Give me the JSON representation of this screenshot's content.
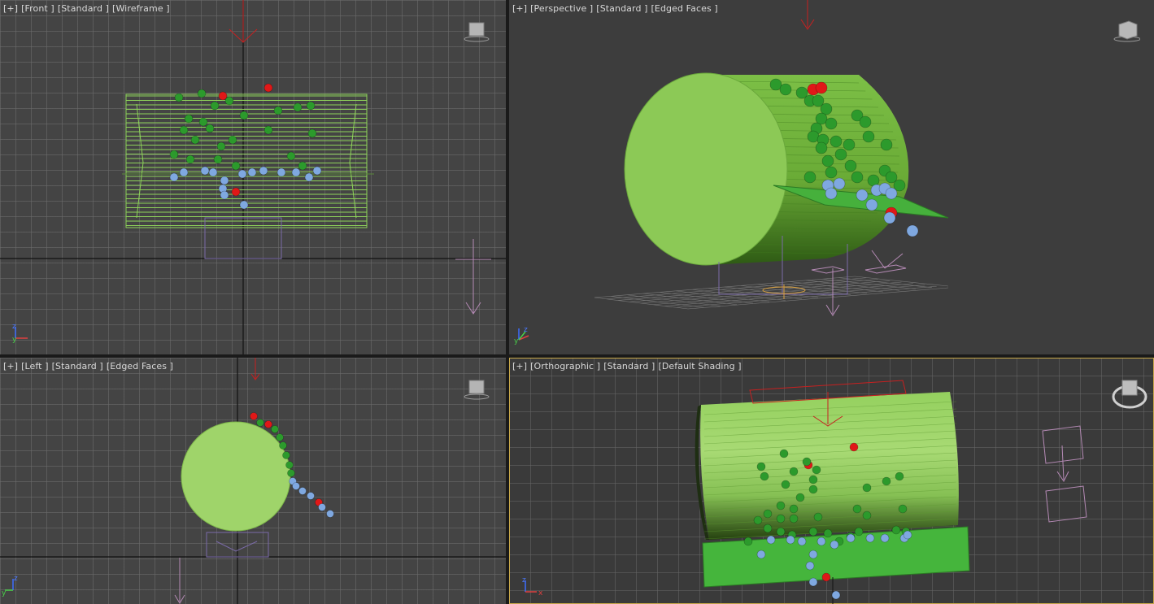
{
  "viewports": {
    "front": {
      "label_plus": "[+]",
      "label_view": "[Front ]",
      "label_style": "[Standard ]",
      "label_shading": "[Wireframe ]"
    },
    "perspective": {
      "label_plus": "[+]",
      "label_view": "[Perspective ]",
      "label_style": "[Standard ]",
      "label_shading": "[Edged Faces ]"
    },
    "left": {
      "label_plus": "[+]",
      "label_view": "[Left ]",
      "label_style": "[Standard ]",
      "label_shading": "[Edged Faces ]"
    },
    "orthographic": {
      "label_plus": "[+]",
      "label_view": "[Orthographic ]",
      "label_style": "[Standard ]",
      "label_shading": "[Default Shading ]"
    }
  },
  "axes": {
    "z": "z",
    "y": "y",
    "x": "x"
  },
  "colors": {
    "grid": "#6e6e6e",
    "active_border": "#c8a84a",
    "cylinder": "#8ed35a",
    "green_particle": "#2c9a2c",
    "blue_particle": "#7fa8e0",
    "red_particle": "#e01818",
    "gizmo_purple": "#b58ab5",
    "target_red": "#c82020"
  },
  "icons": [
    "viewcube-icon",
    "axis-tripod-icon",
    "compass-ring-icon"
  ]
}
